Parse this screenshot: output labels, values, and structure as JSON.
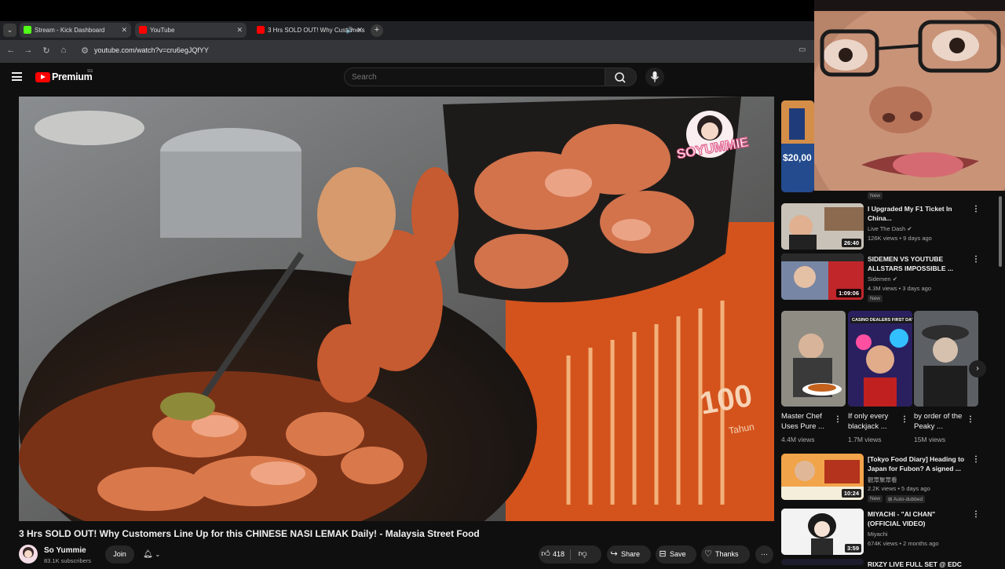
{
  "browser": {
    "tabs": [
      {
        "title": "Stream - Kick Dashboard",
        "favicon_color": "#53fc18"
      },
      {
        "title": "YouTube",
        "favicon_color": "#ff0000"
      },
      {
        "title": "3 Hrs SOLD OUT! Why Customers Line Up for this CHINESE NASI LEMAK Daily!",
        "favicon_color": "#ff0000"
      }
    ],
    "url": "youtube.com/watch?v=cru6egJQfYY"
  },
  "header": {
    "brand": "Premium",
    "region": "SG",
    "search_placeholder": "Search"
  },
  "video": {
    "watermark": "SOYUMMIE",
    "apron_number": "100",
    "apron_text": "Tahun",
    "title": "3 Hrs SOLD OUT! Why Customers Line Up for this CHINESE NASI LEMAK Daily! - Malaysia Street Food",
    "channel": "So Yummie",
    "subscribers": "83.1K subscribers",
    "join_label": "Join",
    "likes": "418",
    "share_label": "Share",
    "save_label": "Save",
    "thanks_label": "Thanks"
  },
  "recommendations": {
    "top_badge": "New",
    "top_thumb_text": "$20,00",
    "items": [
      {
        "title": "I Upgraded My F1 Ticket In China...",
        "channel": "Live The Dash",
        "meta": "126K views • 9 days ago",
        "duration": "26:40",
        "badges": []
      },
      {
        "title": "SIDEMEN VS YOUTUBE ALLSTARS IMPOSSIBLE ...",
        "channel": "Sidemen",
        "meta": "4.3M views • 3 days ago",
        "duration": "1:09:06",
        "badges": [
          "New"
        ]
      },
      {
        "title": "[Tokyo Food Diary] Heading to Japan for Fubon? A signed ...",
        "channel": "觀眾聚眾看",
        "meta": "2.2K views • 5 days ago",
        "duration": "10:24",
        "badges": [
          "New",
          "Auto-dubbed"
        ]
      },
      {
        "title": "MIYACHI - \"AI CHAN\" (OFFICIAL VIDEO)",
        "channel": "Miyachi",
        "meta": "674K views • 2 months ago",
        "duration": "3:59",
        "badges": []
      },
      {
        "title": "RIXZY LIVE FULL SET @ EDC",
        "channel": "",
        "meta": "",
        "duration": "",
        "badges": []
      }
    ],
    "shorts": [
      {
        "title": "Master Chef Uses Pure ...",
        "views": "4.4M views"
      },
      {
        "title": "If only every blackjack ...",
        "views": "1.7M views",
        "thumb_text": "CASINO DEALERS FIRST DAY:"
      },
      {
        "title": "by order of the Peaky ...",
        "views": "15M views"
      }
    ]
  }
}
